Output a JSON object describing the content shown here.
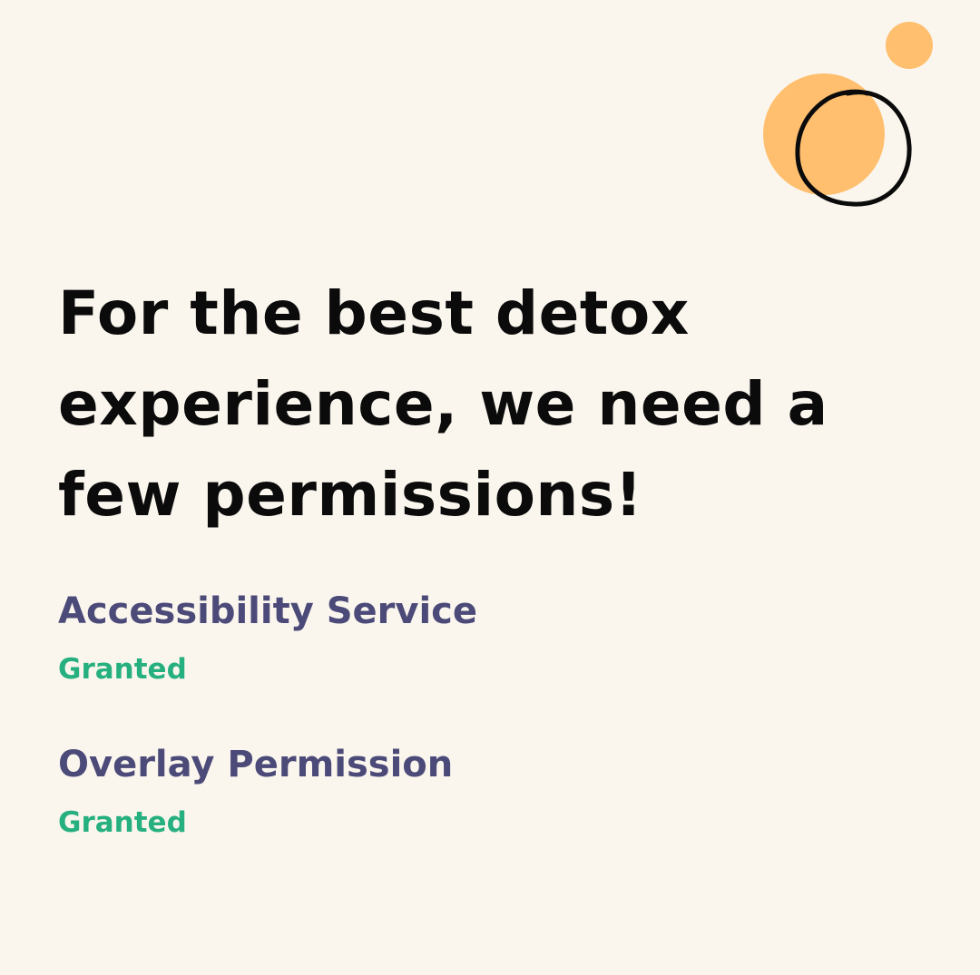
{
  "headline": "For the best detox experience, we need a few permissions!",
  "permissions": [
    {
      "title": "Accessibility Service",
      "status": "Granted"
    },
    {
      "title": "Overlay Permission",
      "status": "Granted"
    }
  ],
  "colors": {
    "background": "#FAF6EE",
    "headline": "#0B0B0B",
    "permission_title": "#4C4A78",
    "status_granted": "#27B07F",
    "accent_orange": "#FFBF6E"
  },
  "decoration": {
    "icon": "sun-moon-doodle-icon"
  }
}
